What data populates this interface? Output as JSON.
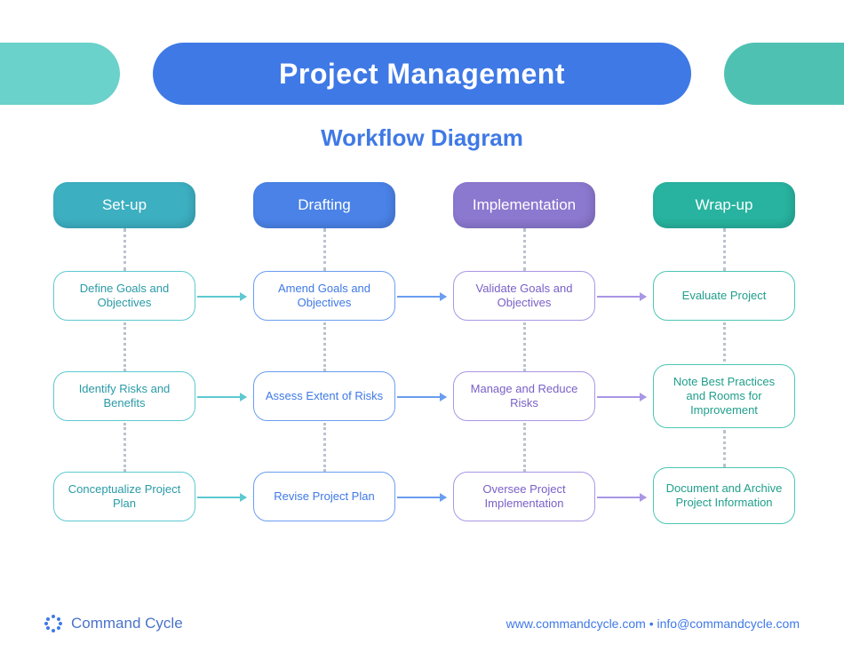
{
  "title": "Project Management",
  "subtitle": "Workflow Diagram",
  "stages": [
    {
      "key": "setup",
      "label": "Set-up",
      "color": "teal"
    },
    {
      "key": "draft",
      "label": "Drafting",
      "color": "blue"
    },
    {
      "key": "impl",
      "label": "Implementation",
      "color": "purple"
    },
    {
      "key": "wrap",
      "label": "Wrap-up",
      "color": "green"
    }
  ],
  "rows": [
    {
      "setup": "Define Goals and Objectives",
      "draft": "Amend Goals and Objectives",
      "impl": "Validate Goals and Objectives",
      "wrap": "Evaluate Project"
    },
    {
      "setup": "Identify Risks and Benefits",
      "draft": "Assess Extent of Risks",
      "impl": "Manage and Reduce Risks",
      "wrap": "Note Best Practices and Rooms for Improvement"
    },
    {
      "setup": "Conceptualize Project Plan",
      "draft": "Revise Project Plan",
      "impl": "Oversee Project Implementation",
      "wrap": "Document and Archive Project Information"
    }
  ],
  "footer": {
    "brand": "Command Cycle",
    "website": "www.commandcycle.com",
    "email": "info@commandcycle.com",
    "sep": "  •  "
  },
  "colors": {
    "teal": "#3cafc1",
    "blue": "#4a82e7",
    "purple": "#8b78cf",
    "green": "#27b39f"
  }
}
